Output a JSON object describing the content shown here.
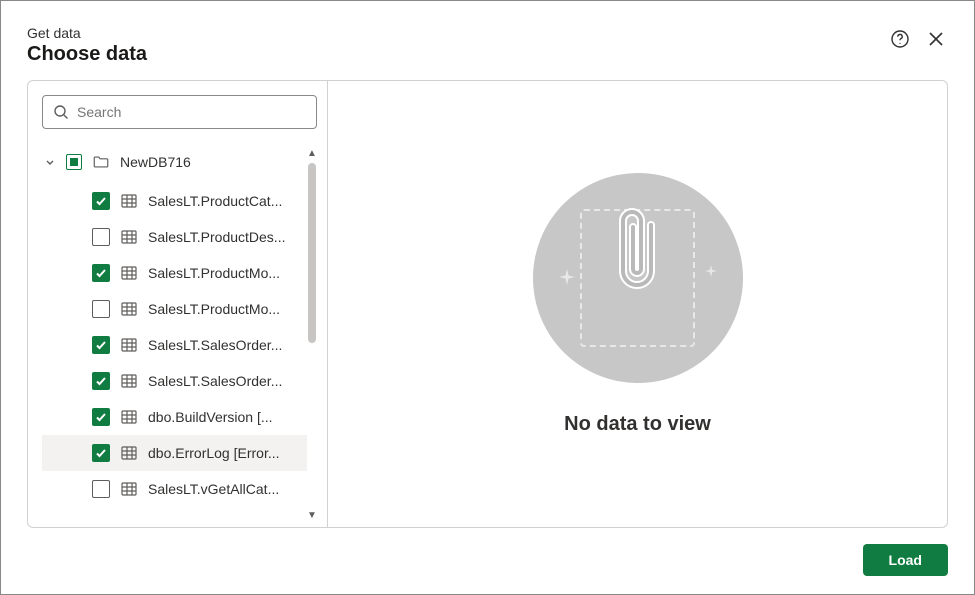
{
  "header": {
    "supertitle": "Get data",
    "title": "Choose data"
  },
  "search": {
    "placeholder": "Search",
    "value": ""
  },
  "tree": {
    "root": {
      "label": "NewDB716",
      "state": "indeterminate",
      "expanded": true
    },
    "items": [
      {
        "label": "SalesLT.ProductCat...",
        "checked": true,
        "selected": false
      },
      {
        "label": "SalesLT.ProductDes...",
        "checked": false,
        "selected": false
      },
      {
        "label": "SalesLT.ProductMo...",
        "checked": true,
        "selected": false
      },
      {
        "label": "SalesLT.ProductMo...",
        "checked": false,
        "selected": false
      },
      {
        "label": "SalesLT.SalesOrder...",
        "checked": true,
        "selected": false
      },
      {
        "label": "SalesLT.SalesOrder...",
        "checked": true,
        "selected": false
      },
      {
        "label": "dbo.BuildVersion [...",
        "checked": true,
        "selected": false
      },
      {
        "label": "dbo.ErrorLog [Error...",
        "checked": true,
        "selected": true
      },
      {
        "label": "SalesLT.vGetAllCat...",
        "checked": false,
        "selected": false
      }
    ]
  },
  "empty": {
    "message": "No data to view"
  },
  "footer": {
    "load_label": "Load"
  }
}
